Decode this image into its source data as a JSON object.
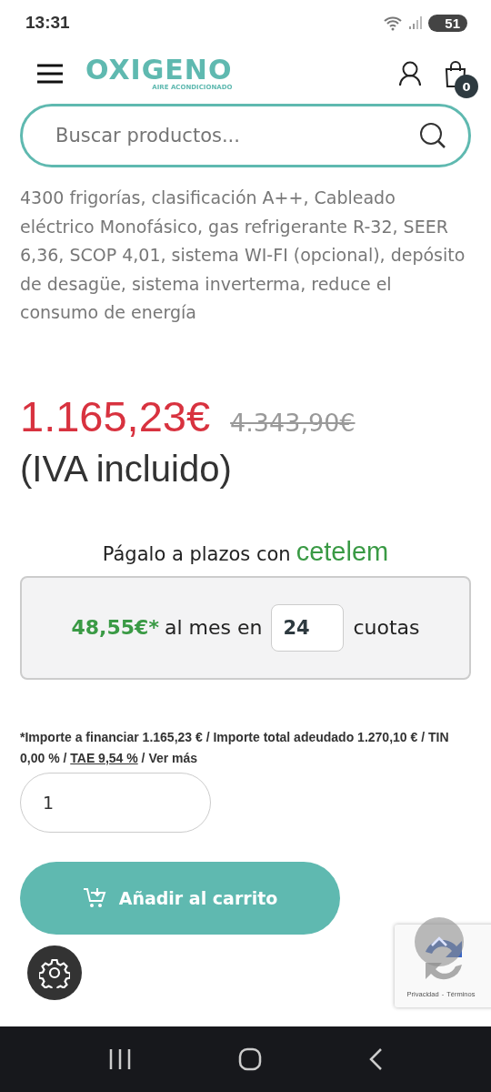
{
  "status_bar": {
    "time": "13:31",
    "battery": "51"
  },
  "header": {
    "logo": "OXIGENO",
    "logo_tagline": "AIRE ACONDICIONADO",
    "cart_count": "0"
  },
  "search": {
    "placeholder": "Buscar productos..."
  },
  "product": {
    "description": "4300 frigorías, clasificación A++, Cableado eléctrico Monofásico, gas refrigerante R-32, SEER 6,36, SCOP 4,01, sistema WI-FI (opcional), depósito de desagüe, sistema inverterma, reduce el consumo de energía",
    "price": "1.165,23€",
    "old_price": "4.343,90€",
    "tax_note": "(IVA incluido)"
  },
  "financing": {
    "title": "Págalo a plazos con",
    "brand": "cetelem",
    "monthly": "48,55€*",
    "text_middle": "al mes en",
    "installments": "24",
    "text_end": "cuotas",
    "disclaimer_1": "*Importe a financiar 1.165,23 € / Importe total adeudado 1.270,10 € / TIN 0,00 % / ",
    "tae_link": "TAE 9,54 %",
    "separator": " / ",
    "more_link": "Ver más"
  },
  "quantity": {
    "value": "1"
  },
  "add_to_cart": {
    "label": "Añadir al carrito"
  },
  "recaptcha": {
    "privacy": "Privacidad",
    "dash": "-",
    "terms": "Términos"
  }
}
